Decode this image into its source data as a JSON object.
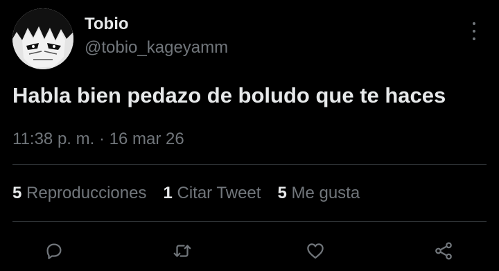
{
  "tweet": {
    "display_name": "Tobio",
    "handle": "@tobio_kageyamm",
    "text": "Habla bien pedazo de boludo que te haces",
    "time": "11:38 p. m.",
    "separator": "·",
    "date": "16 mar 26"
  },
  "stats": [
    {
      "count": "5",
      "label": "Reproducciones"
    },
    {
      "count": "1",
      "label": "Citar Tweet"
    },
    {
      "count": "5",
      "label": "Me gusta"
    }
  ],
  "icons": {
    "avatar": "manga-character-avatar",
    "more": "more-vertical-icon",
    "reply": "reply-icon",
    "retweet": "retweet-icon",
    "like": "heart-icon",
    "share": "share-icon"
  },
  "colors": {
    "background": "#000000",
    "primary_text": "#e7e9ea",
    "secondary_text": "#71767b",
    "divider": "#2f3336"
  }
}
